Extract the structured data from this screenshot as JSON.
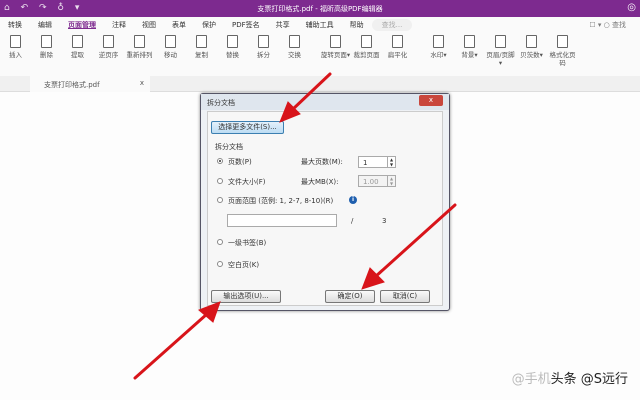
{
  "titlebar": {
    "quick_access": "⌂ ↶ ↷ ♁ ▾",
    "title": "支票打印格式.pdf - 福昕高级PDF编辑器",
    "user_icon": "◎"
  },
  "menu": {
    "items": [
      "转换",
      "编辑",
      "页面管理",
      "注释",
      "视图",
      "表单",
      "保护",
      "PDF签名",
      "共享",
      "辅助工具",
      "帮助"
    ],
    "search_placeholder": "查找...",
    "right": "☐ ▾  ○ 查找"
  },
  "toolbar": {
    "items": [
      "插入",
      "删除",
      "提取",
      "逆页序",
      "重新排列",
      "移动",
      "复制",
      "替换",
      "拆分",
      "交换",
      "旋转页面▾",
      "裁剪页面",
      "扁平化",
      "水印▾",
      "背景▾",
      "页眉/页脚▾",
      "贝茨数▾",
      "格式化页码"
    ]
  },
  "tab": {
    "label": "支票打印格式.pdf",
    "close": "x"
  },
  "dialog": {
    "title": "拆分文档",
    "close": "x",
    "select_files": "选择更多文件(S)...",
    "group_title": "拆分文档",
    "options": [
      "页数(P)",
      "文件大小(F)",
      "页面范围 (范例: 1, 2-7, 8-10)(R)",
      "一级书签(B)",
      "空白页(K)"
    ],
    "max_pages_label": "最大页数(M):",
    "max_pages_value": "1",
    "max_mb_label": "最大MB(X):",
    "max_mb_value": "1.00",
    "range_separator": "/",
    "total_pages": "3",
    "output_options": "输出选项(U)...",
    "ok": "确定(O)",
    "cancel": "取消(C)"
  },
  "watermark": {
    "faint": "@手机",
    "text": "头条 @S远行"
  }
}
